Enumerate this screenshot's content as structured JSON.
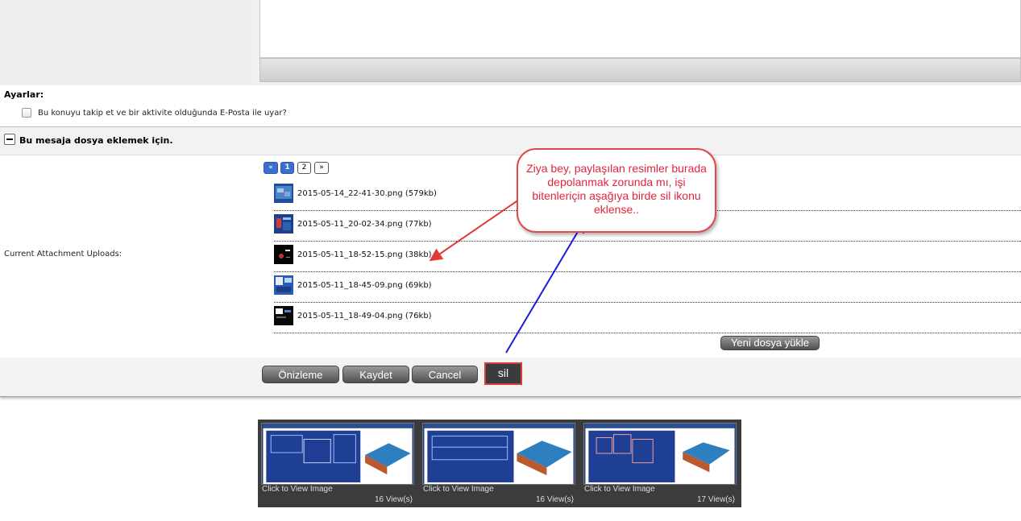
{
  "settings": {
    "label": "Ayarlar:",
    "notify_label": "Bu konuyu takip et ve bir aktivite olduğunda E-Posta ile uyar?"
  },
  "attachments": {
    "title": "Bu mesaja dosya eklemek için.",
    "uploads_label": "Current Attachment Uploads:",
    "pager": [
      "«",
      "1",
      "2",
      "»"
    ],
    "files": [
      {
        "name": "2015-05-14_22-41-30.png (579kb)"
      },
      {
        "name": "2015-05-11_20-02-34.png (77kb)"
      },
      {
        "name": "2015-05-11_18-52-15.png (38kb)"
      },
      {
        "name": "2015-05-11_18-45-09.png (69kb)"
      },
      {
        "name": "2015-05-11_18-49-04.png (76kb)"
      }
    ],
    "upload_button": "Yeni dosya yükle"
  },
  "actions": {
    "preview": "Önizleme",
    "save": "Kaydet",
    "cancel": "Cancel",
    "delete": "sil"
  },
  "callout": {
    "text": "Ziya bey, paylaşılan resimler burada depolanmak zorunda mı, işi bitenleriçin aşağıya birde sil ikonu eklense.."
  },
  "gallery": [
    {
      "caption": "Click to View Image",
      "views": "16 View(s)"
    },
    {
      "caption": "Click to View Image",
      "views": "16 View(s)"
    },
    {
      "caption": "Click to View Image",
      "views": "17 View(s)"
    }
  ],
  "colors": {
    "accent": "#3a6fd0",
    "callout_border": "#e04a4a",
    "callout_text": "#e0263c",
    "arrow_red": "#e03a3a",
    "arrow_blue": "#1a1ae0"
  }
}
